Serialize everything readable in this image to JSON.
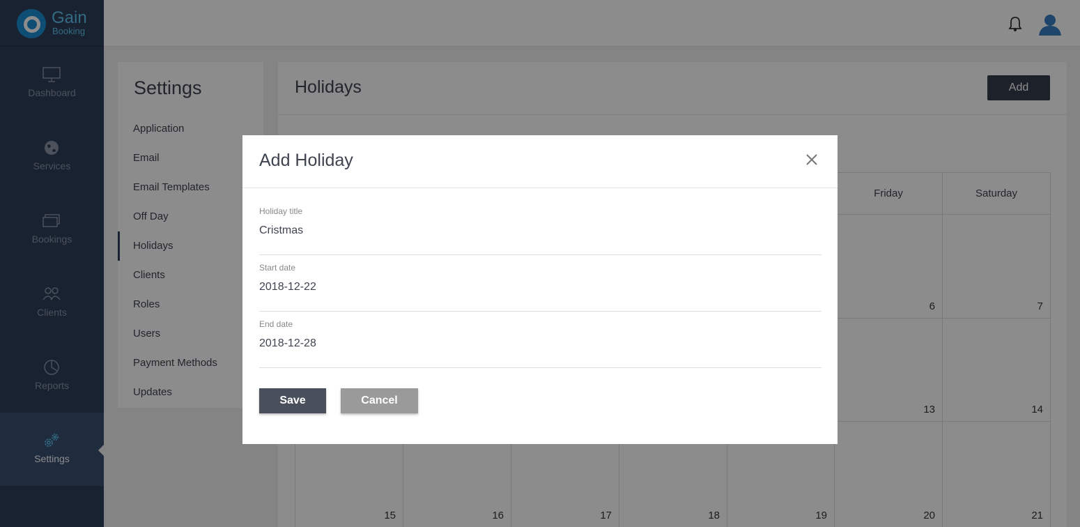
{
  "brand": {
    "name": "Gain",
    "sub": "Booking"
  },
  "nav": [
    {
      "label": "Dashboard",
      "icon": "monitor-icon"
    },
    {
      "label": "Services",
      "icon": "globe-icon"
    },
    {
      "label": "Bookings",
      "icon": "cards-icon"
    },
    {
      "label": "Clients",
      "icon": "users-icon"
    },
    {
      "label": "Reports",
      "icon": "pie-chart-icon"
    },
    {
      "label": "Settings",
      "icon": "gears-icon"
    }
  ],
  "topbar": {
    "bell_icon": "bell-icon",
    "avatar_icon": "user-avatar-icon"
  },
  "settings": {
    "title": "Settings",
    "items": [
      "Application",
      "Email",
      "Email Templates",
      "Off Day",
      "Holidays",
      "Clients",
      "Roles",
      "Users",
      "Payment Methods",
      "Updates"
    ],
    "active": "Holidays"
  },
  "holidays": {
    "title": "Holidays",
    "add_label": "Add",
    "calendar": {
      "visible_headers": [
        {
          "col": 5,
          "label": "Friday"
        },
        {
          "col": 6,
          "label": "Saturday"
        }
      ],
      "rows": [
        [
          "",
          "",
          "",
          "",
          "",
          "6",
          "7"
        ],
        [
          "",
          "",
          "",
          "",
          "",
          "13",
          "14"
        ],
        [
          "15",
          "16",
          "17",
          "18",
          "19",
          "20",
          "21"
        ]
      ]
    }
  },
  "modal": {
    "title": "Add Holiday",
    "close_icon": "close-icon",
    "fields": {
      "title": {
        "label": "Holiday title",
        "value": "Cristmas"
      },
      "start": {
        "label": "Start date",
        "value": "2018-12-22"
      },
      "end": {
        "label": "End date",
        "value": "2018-12-28"
      }
    },
    "save_label": "Save",
    "cancel_label": "Cancel"
  }
}
